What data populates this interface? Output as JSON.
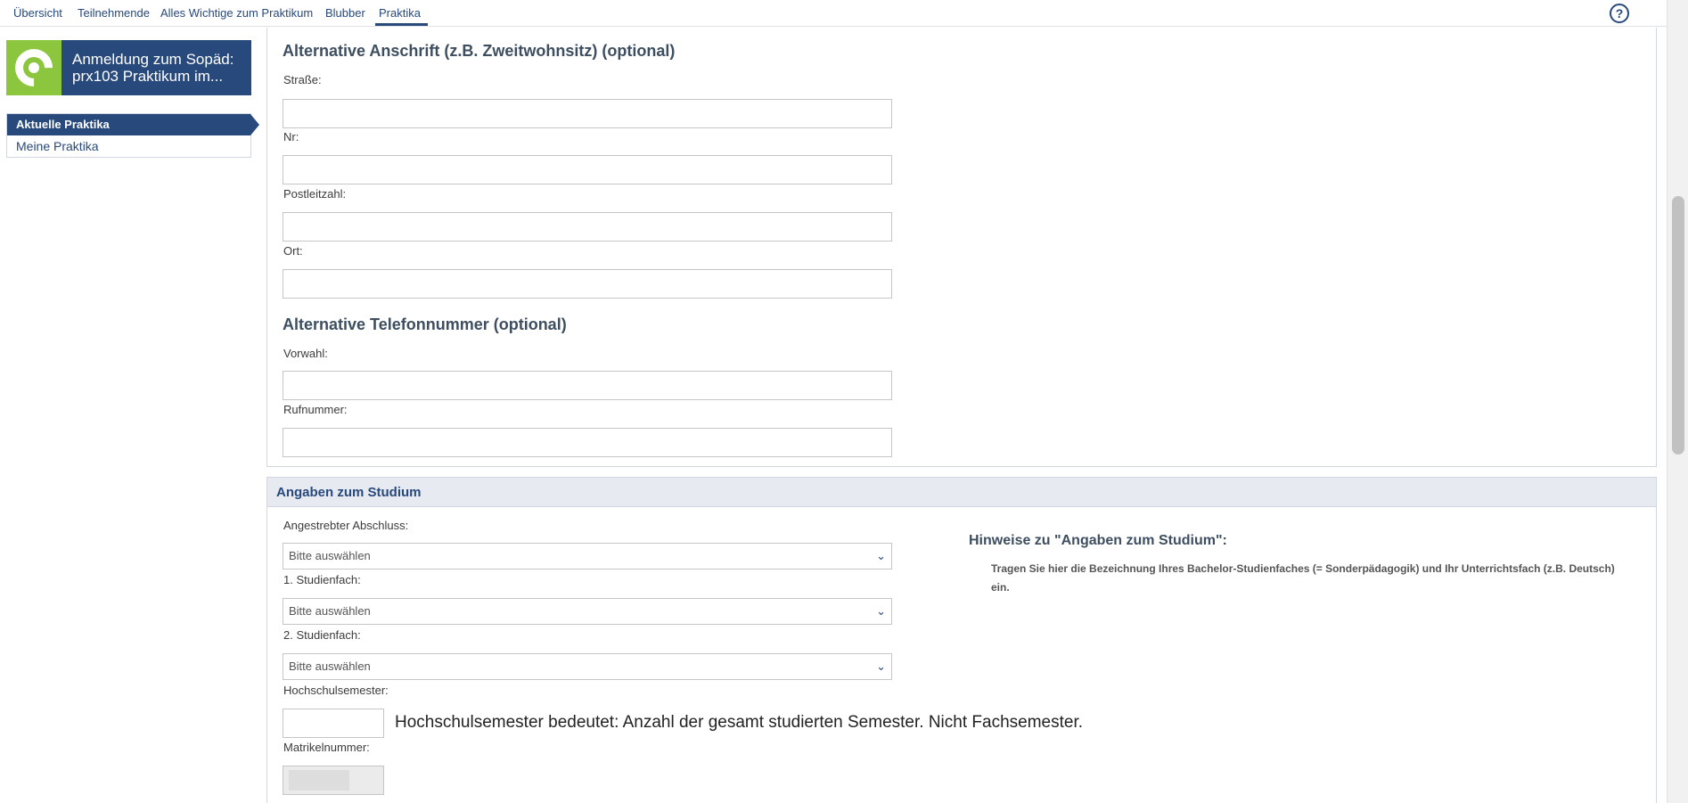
{
  "topnav": {
    "tabs": [
      {
        "label": "Übersicht"
      },
      {
        "label": "Teilnehmende"
      },
      {
        "label": "Alles Wichtige zum Praktikum"
      },
      {
        "label": "Blubber"
      },
      {
        "label": "Praktika"
      }
    ],
    "active_tab": "Praktika",
    "help_label": "?"
  },
  "sidebar": {
    "context_title": "Anmeldung zum Sopäd: prx103 Praktikum im...",
    "items": [
      {
        "label": "Aktuelle Praktika",
        "active": true
      },
      {
        "label": "Meine Praktika",
        "active": false
      }
    ]
  },
  "alt_address": {
    "heading": "Alternative Anschrift (z.B. Zweitwohnsitz) (optional)",
    "street_label": "Straße:",
    "street_value": "",
    "number_label": "Nr:",
    "number_value": "",
    "zip_label": "Postleitzahl:",
    "zip_value": "",
    "city_label": "Ort:",
    "city_value": ""
  },
  "alt_phone": {
    "heading": "Alternative Telefonnummer (optional)",
    "area_label": "Vorwahl:",
    "area_value": "",
    "number_label": "Rufnummer:",
    "number_value": ""
  },
  "study": {
    "section_title": "Angaben zum Studium",
    "degree_label": "Angestrebter Abschluss:",
    "degree_value": "Bitte auswählen",
    "subject1_label": "1. Studienfach:",
    "subject1_value": "Bitte auswählen",
    "subject2_label": "2. Studienfach:",
    "subject2_value": "Bitte auswählen",
    "semester_label": "Hochschulsemester:",
    "semester_value": "",
    "semester_note": "Hochschulsemester bedeutet: Anzahl der gesamt studierten Semester. Nicht Fachsemester.",
    "matrikel_label": "Matrikelnummer:",
    "hint_heading": "Hinweise zu \"Angaben zum Studium\":",
    "hint_text": "Tragen Sie hier die Bezeichnung Ihres Bachelor-Studienfaches (= Sonderpädagogik) und Ihr Unterrichtsfach (z.B. Deutsch) ein."
  },
  "colors": {
    "brand_blue": "#28497c",
    "logo_green": "#8cc63f",
    "section_bg": "#e7ebf1"
  }
}
